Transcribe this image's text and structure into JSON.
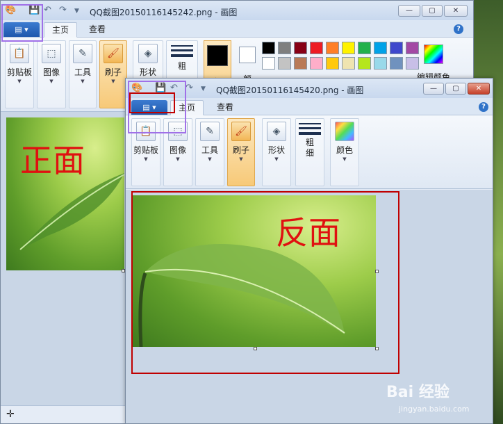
{
  "back": {
    "title": "QQ截图20150116145242.png - 画图",
    "tabs": {
      "home": "主页",
      "view": "查看"
    },
    "groups": {
      "clipboard": "剪贴板",
      "image": "图像",
      "tools": "工具",
      "brush": "刷子",
      "shapes": "形状",
      "size": "粗",
      "color1": "颜",
      "color2": "颜",
      "edit_colors": "编辑颜色"
    },
    "canvas_label": "正面",
    "status_icon": "✛"
  },
  "front": {
    "title": "QQ截图20150116145420.png - 画图",
    "tabs": {
      "home": "主页",
      "view": "查看"
    },
    "groups": {
      "clipboard": "剪贴板",
      "image": "图像",
      "tools": "工具",
      "brush": "刷子",
      "shapes": "形状",
      "size": "粗\n细",
      "colors": "颜色"
    },
    "canvas_label": "反面"
  },
  "palette": [
    "#000000",
    "#7f7f7f",
    "#880015",
    "#ed1c24",
    "#ff7f27",
    "#fff200",
    "#22b14c",
    "#00a2e8",
    "#3f48cc",
    "#a349a4",
    "#ffffff",
    "#c3c3c3",
    "#b97a57",
    "#ffaec9",
    "#ffc90e",
    "#efe4b0",
    "#b5e61d",
    "#99d9ea",
    "#7092be",
    "#c8bfe7"
  ],
  "window_buttons": {
    "min": "—",
    "max": "▢",
    "close": "✕"
  },
  "help": "?",
  "watermark": {
    "main": "Bai 经验",
    "sub": "jingyan.baidu.com"
  },
  "colors": {
    "highlight_purple": "#a070e8",
    "highlight_red": "#c00000",
    "text_red": "#e01010"
  }
}
